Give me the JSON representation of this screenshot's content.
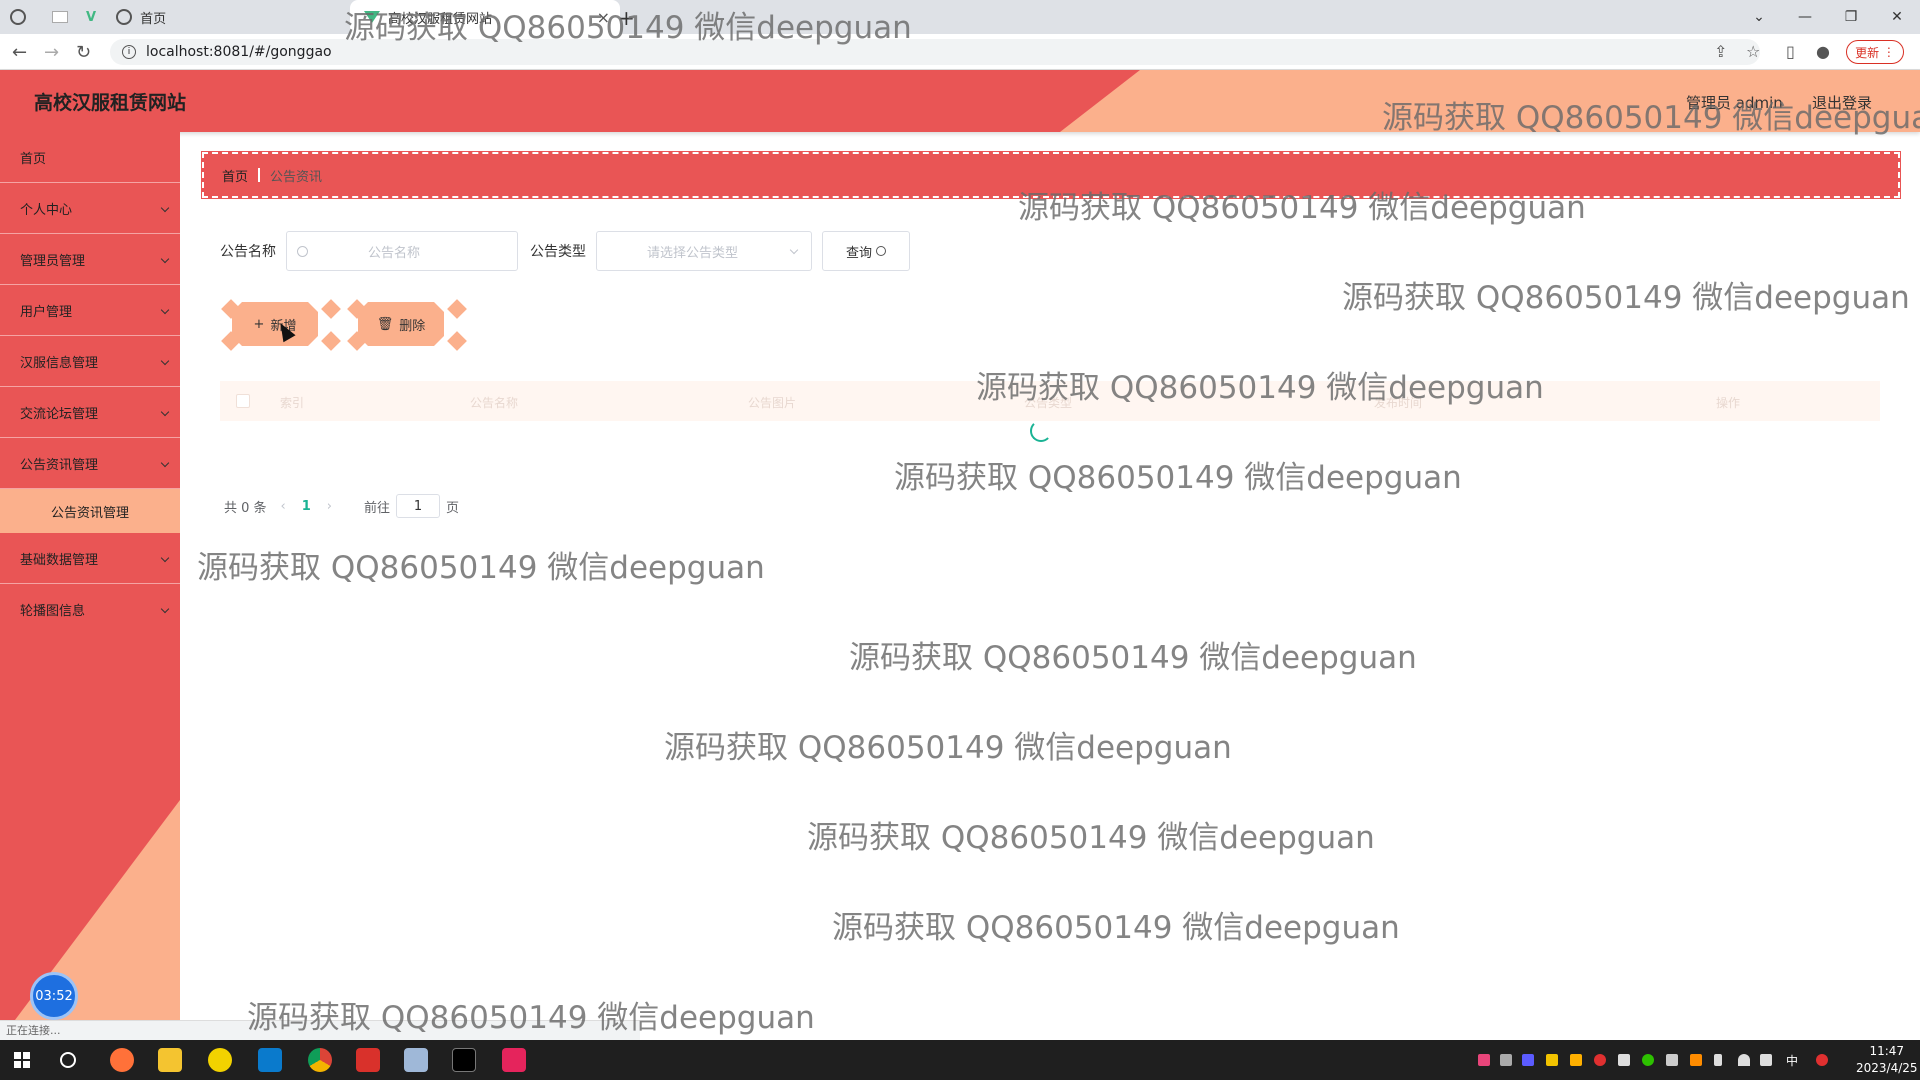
{
  "browser": {
    "tabs": [
      {
        "label": "首页"
      },
      {
        "label": "高校汉服租赁网站"
      }
    ],
    "url": "localhost:8081/#/gonggao",
    "update_label": "更新",
    "status_text": "正在连接..."
  },
  "header": {
    "site_title": "高校汉服租赁网站",
    "user_label": "管理员 admin",
    "logout_label": "退出登录"
  },
  "sidebar": {
    "items": [
      {
        "label": "首页",
        "has_children": false
      },
      {
        "label": "个人中心",
        "has_children": true
      },
      {
        "label": "管理员管理",
        "has_children": true
      },
      {
        "label": "用户管理",
        "has_children": true
      },
      {
        "label": "汉服信息管理",
        "has_children": true
      },
      {
        "label": "交流论坛管理",
        "has_children": true
      },
      {
        "label": "公告资讯管理",
        "has_children": true
      }
    ],
    "submenu_active": "公告资讯管理",
    "items_after": [
      {
        "label": "基础数据管理"
      },
      {
        "label": "轮播图信息"
      }
    ],
    "timer": "03:52"
  },
  "breadcrumb": {
    "home": "首页",
    "current": "公告资讯"
  },
  "search": {
    "name_label": "公告名称",
    "name_placeholder": "公告名称",
    "type_label": "公告类型",
    "type_placeholder": "请选择公告类型",
    "query_label": "查询"
  },
  "actions": {
    "add_label": "新增",
    "delete_label": "删除"
  },
  "table": {
    "columns": [
      "索引",
      "公告名称",
      "公告图片",
      "公告类型",
      "发布时间",
      "操作"
    ]
  },
  "pagination": {
    "total_text": "共 0 条",
    "current_page": "1",
    "goto_label": "前往",
    "goto_value": "1",
    "page_unit": "页"
  },
  "watermark": "源码获取 QQ86050149 微信deepguan",
  "taskbar": {
    "time": "11:47",
    "date": "2023/4/25",
    "ime": "中"
  }
}
